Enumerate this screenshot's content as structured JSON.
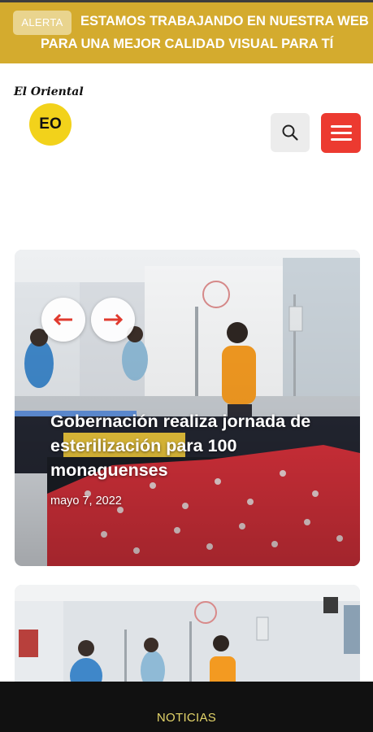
{
  "alert": {
    "badge": "ALERTA",
    "line1": "ESTAMOS TRABAJANDO EN NUESTRA WEB",
    "line2": "PARA UNA MEJOR CALIDAD VISUAL PARA TÍ"
  },
  "header": {
    "logo_text": "El Oriental",
    "logo_badge": "EO",
    "search_icon": "search-icon",
    "menu_icon": "hamburger-menu-icon"
  },
  "slider": {
    "prev_icon": "arrow-left-icon",
    "next_icon": "arrow-right-icon",
    "headline": "Gobernación realiza jornada de esterilización para 100 monaguenses",
    "date": "mayo 7, 2022"
  },
  "bottom_nav": {
    "label": "NOTICIAS"
  },
  "colors": {
    "alert_bg": "#d4ab2e",
    "menu_button": "#ec3a30",
    "arrow": "#e03a2e",
    "bottom_bar": "#111111",
    "bottom_label": "#e4d56a"
  }
}
